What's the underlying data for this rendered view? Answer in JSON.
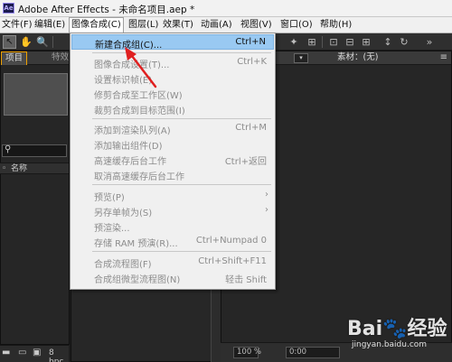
{
  "window": {
    "title": "Adobe After Effects - 未命名项目.aep *",
    "app_icon_text": "Ae"
  },
  "menubar": {
    "items": [
      "文件(F)",
      "编辑(E)",
      "图像合成(C)",
      "图层(L)",
      "效果(T)",
      "动画(A)",
      "视图(V)",
      "窗口(O)",
      "帮助(H)"
    ],
    "active_index": 2
  },
  "panels": {
    "project_tab": "项目",
    "effects_tab_partial": "特效",
    "list_name_header": "名称",
    "footer_bpc": "8 bpc",
    "right_tab": "素材：(无)",
    "zoom": "100 %",
    "timecode_partial": "0:00"
  },
  "composition_menu": {
    "items": [
      {
        "label": "新建合成组(C)...",
        "shortcut": "Ctrl+N",
        "enabled": true,
        "highlight": true
      },
      {
        "separator": true
      },
      {
        "label": "图像合成设置(T)...",
        "shortcut": "Ctrl+K",
        "enabled": false
      },
      {
        "label": "设置标识帧(E)",
        "shortcut": "",
        "enabled": false
      },
      {
        "label": "修剪合成至工作区(W)",
        "shortcut": "",
        "enabled": false
      },
      {
        "label": "裁剪合成到目标范围(I)",
        "shortcut": "",
        "enabled": false
      },
      {
        "separator": true
      },
      {
        "label": "添加到渲染队列(A)",
        "shortcut": "Ctrl+M",
        "enabled": false
      },
      {
        "label": "添加输出组件(D)",
        "shortcut": "",
        "enabled": false
      },
      {
        "label": "高速缓存后台工作",
        "shortcut": "Ctrl+返回",
        "enabled": false
      },
      {
        "label": "取消高速缓存后台工作",
        "shortcut": "",
        "enabled": false
      },
      {
        "separator": true
      },
      {
        "label": "预览(P)",
        "shortcut": "",
        "enabled": false,
        "submenu": true
      },
      {
        "label": "另存单帧为(S)",
        "shortcut": "",
        "enabled": false,
        "submenu": true
      },
      {
        "label": "预渲染...",
        "shortcut": "",
        "enabled": false
      },
      {
        "label": "存储 RAM 预演(R)...",
        "shortcut": "Ctrl+Numpad 0",
        "enabled": false
      },
      {
        "separator": true
      },
      {
        "label": "合成流程图(F)",
        "shortcut": "Ctrl+Shift+F11",
        "enabled": false
      },
      {
        "label": "合成组微型流程图(N)",
        "shortcut": "轻击 Shift",
        "enabled": false
      }
    ]
  },
  "watermark": {
    "logo": "Bai🐾经验",
    "sub": "jingyan.baidu.com"
  },
  "colors": {
    "menu_highlight": "#99c9f2",
    "annotation_arrow": "#e02020",
    "active_tab_outline": "#f0a000"
  },
  "icons": [
    "selection-tool-icon",
    "hand-tool-icon",
    "zoom-tool-icon",
    "search-icon",
    "folder-icon",
    "trash-icon",
    "submenu-arrow-icon"
  ]
}
